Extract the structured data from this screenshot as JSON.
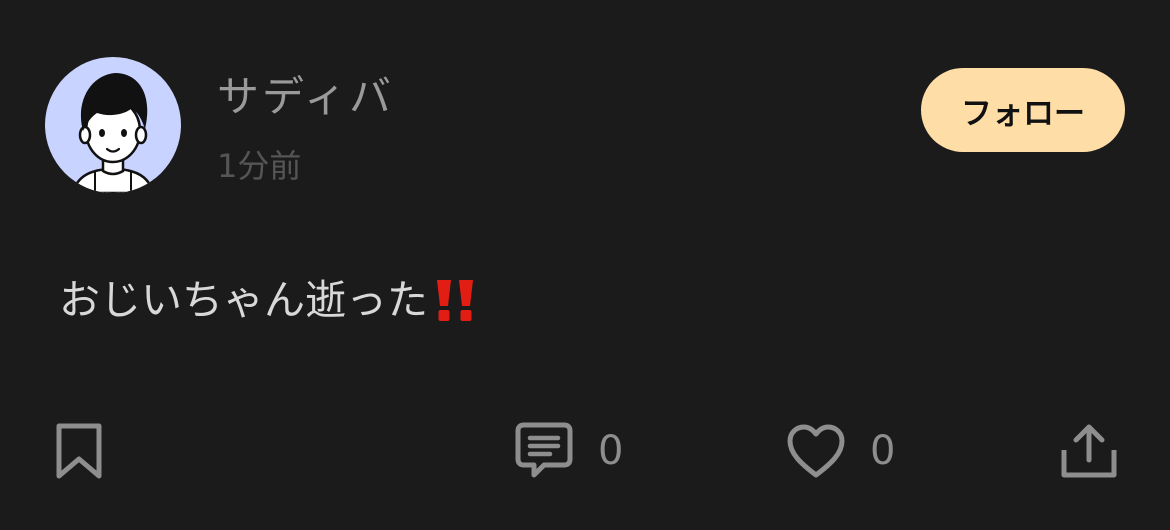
{
  "post": {
    "author": {
      "name": "サディバ",
      "avatar_icon": "user-avatar-icon"
    },
    "time_ago": "1分前",
    "follow_label": "フォロー",
    "text": "おじいちゃん逝った",
    "emoji": "double-exclamation-icon"
  },
  "actions": {
    "bookmark_icon": "bookmark-icon",
    "comment_icon": "comment-icon",
    "comment_count": "0",
    "like_icon": "heart-icon",
    "like_count": "0",
    "share_icon": "share-icon"
  },
  "colors": {
    "background": "#1b1b1b",
    "follow_button": "#fedda6",
    "emoji_red": "#e21e14",
    "avatar_bg": "#c9d3ff"
  }
}
